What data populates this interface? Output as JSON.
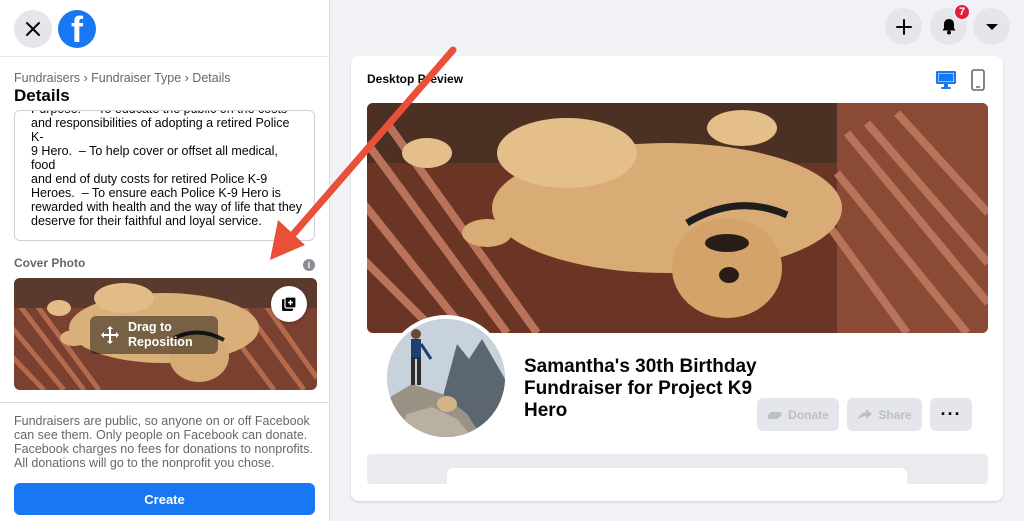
{
  "header": {
    "close_icon": "close-icon",
    "logo_letter": "f",
    "create_icon": "plus-icon",
    "notifications_icon": "bell-icon",
    "notifications_count": "7",
    "account_icon": "caret-down-icon"
  },
  "form": {
    "breadcrumb": "Fundraisers › Fundraiser Type › Details",
    "title": "Details",
    "description": "medical costs, food and end of duty services.\nPurpose:  – To educate the public on the costs\nand responsibilities of adopting a retired Police K-\n9 Hero.  – To help cover or offset all medical, food\nand end of duty costs for retired Police K-9\nHeroes.  – To ensure each Police K-9 Hero is\nrewarded with health and the way of life that they\ndeserve for their faithful and loyal service.",
    "cover_photo_label": "Cover Photo",
    "info_glyph": "i",
    "drag_label": "Drag to\nReposition",
    "disclaimer": "Fundraisers are public, so anyone on or off Facebook can see them. Only people on Facebook can donate. Facebook charges no fees for donations to nonprofits. All donations will go to the nonprofit you chose.",
    "create_label": "Create"
  },
  "preview": {
    "title": "Desktop Preview",
    "fundraiser_title": "Samantha's 30th Birthday Fundraiser for Project K9 Hero",
    "donate_label": "Donate",
    "share_label": "Share",
    "more_label": "···"
  },
  "colors": {
    "primary": "#1877f2",
    "badge": "#e41e3f",
    "annotation_arrow": "#e8503a"
  }
}
